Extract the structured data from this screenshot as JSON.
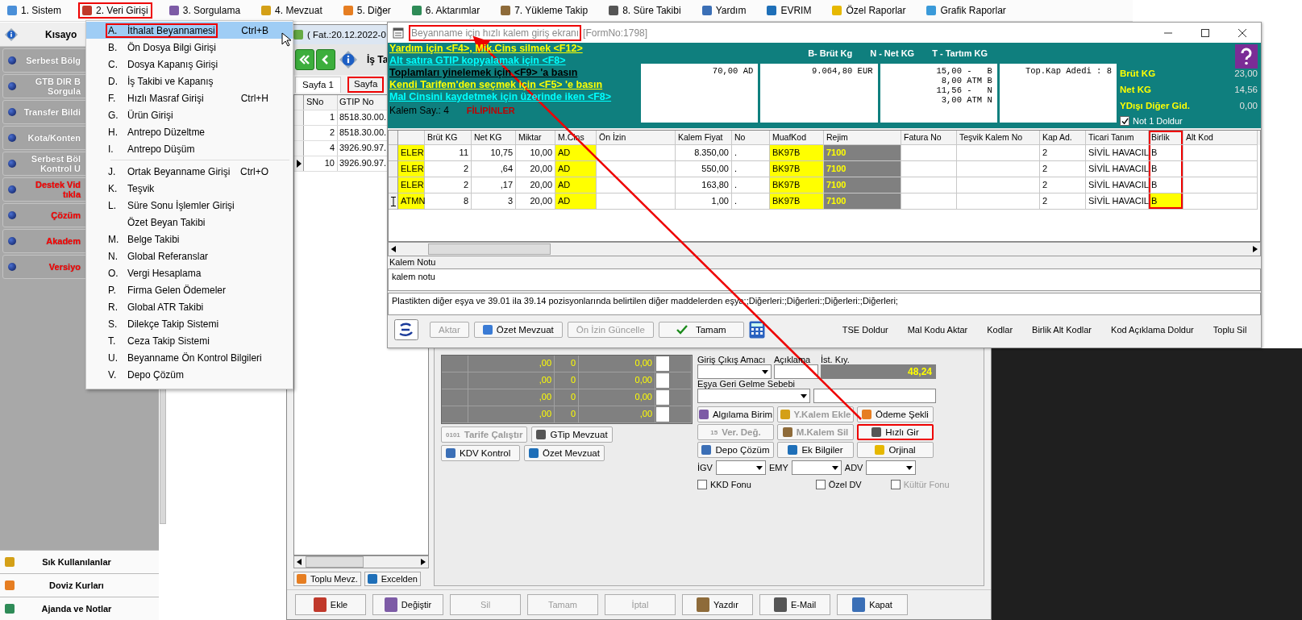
{
  "menu_bar": [
    {
      "label": "1. Sistem",
      "annotated": false
    },
    {
      "label": "2. Veri Girişi",
      "annotated": true
    },
    {
      "label": "3. Sorgulama",
      "annotated": false
    },
    {
      "label": "4. Mevzuat",
      "annotated": false
    },
    {
      "label": "5. Diğer",
      "annotated": false
    },
    {
      "label": "6. Aktarımlar",
      "annotated": false
    },
    {
      "label": "7. Yükleme Takip",
      "annotated": false
    },
    {
      "label": "8. Süre Takibi",
      "annotated": false
    },
    {
      "label": "Yardım",
      "annotated": false
    },
    {
      "label": "EVRIM",
      "annotated": false
    },
    {
      "label": "Özel Raporlar",
      "annotated": false
    },
    {
      "label": "Grafik Raporlar",
      "annotated": false
    }
  ],
  "sidebar": {
    "header": "Kısayo",
    "items": [
      {
        "lines": [
          "Serbest Bölg"
        ],
        "color": "#ffffff"
      },
      {
        "lines": [
          "GTB DIR B",
          "Sorgula"
        ],
        "color": "#ffffff"
      },
      {
        "lines": [
          "Transfer Bildi"
        ],
        "color": "#ffffff"
      },
      {
        "lines": [
          "Kota/Konten"
        ],
        "color": "#ffffff"
      },
      {
        "lines": [
          "Serbest Böl",
          "Kontrol U"
        ],
        "color": "#ffffff"
      },
      {
        "lines": [
          "Destek Vid",
          "tıkla"
        ],
        "color": "#ff0000"
      },
      {
        "lines": [
          "Çözüm"
        ],
        "color": "#ff0000"
      },
      {
        "lines": [
          "Akadem"
        ],
        "color": "#ff0000"
      },
      {
        "lines": [
          "Versiyo"
        ],
        "color": "#ff0000"
      }
    ],
    "bottom": [
      "Sık Kullanılanlar",
      "Doviz Kurları",
      "Ajanda ve Notlar"
    ]
  },
  "veri_girisi_menu": {
    "groups": [
      [
        {
          "letter": "A.",
          "text": "İthalat Beyannamesi",
          "shortcut": "Ctrl+B",
          "selected": true,
          "annotated": true
        },
        {
          "letter": "B.",
          "text": "Ön Dosya Bilgi Girişi",
          "selected": false,
          "annotated": false
        },
        {
          "letter": "C.",
          "text": "Dosya Kapanış Girişi",
          "selected": false,
          "annotated": false
        },
        {
          "letter": "D.",
          "text": "İş Takibi ve Kapanış",
          "selected": false,
          "annotated": false
        },
        {
          "letter": "F.",
          "text": "Hızlı Masraf Girişi",
          "shortcut": "Ctrl+H",
          "selected": false,
          "annotated": false
        },
        {
          "letter": "G.",
          "text": "Ürün Girişi",
          "selected": false,
          "annotated": false
        },
        {
          "letter": "H.",
          "text": "Antrepo Düzeltme",
          "selected": false,
          "annotated": false
        },
        {
          "letter": "I.",
          "text": "Antrepo Düşüm",
          "selected": false,
          "annotated": false
        }
      ],
      [
        {
          "letter": "J.",
          "text": "Ortak Beyanname Girişi",
          "shortcut": "Ctrl+O",
          "selected": false,
          "annotated": false
        },
        {
          "letter": "K.",
          "text": "Teşvik",
          "selected": false,
          "annotated": false
        },
        {
          "letter": "L.",
          "text": "Süre Sonu İşlemler Girişi",
          "selected": false,
          "annotated": false
        },
        {
          "text": "Özet Beyan Takibi",
          "selected": false,
          "annotated": false
        },
        {
          "letter": "M.",
          "text": "Belge Takibi",
          "selected": false,
          "annotated": false
        },
        {
          "letter": "N.",
          "text": "Global Referanslar",
          "selected": false,
          "annotated": false
        },
        {
          "letter": "O.",
          "text": "Vergi Hesaplama",
          "selected": false,
          "annotated": false
        },
        {
          "letter": "P.",
          "text": "Firma Gelen Ödemeler",
          "selected": false,
          "annotated": false
        },
        {
          "letter": "R.",
          "text": "Global ATR Takibi",
          "selected": false,
          "annotated": false
        },
        {
          "letter": "S.",
          "text": "Dilekçe Takip Sistemi",
          "selected": false,
          "annotated": false
        },
        {
          "letter": "T.",
          "text": "Ceza Takip Sistemi",
          "selected": false,
          "annotated": false
        },
        {
          "letter": "U.",
          "text": "Beyanname Ön Kontrol Bilgileri",
          "selected": false,
          "annotated": false
        },
        {
          "letter": "V.",
          "text": "Depo Çözüm",
          "selected": false,
          "annotated": false
        }
      ]
    ]
  },
  "main_window": {
    "title": "( Fat.:20.12.2022-0",
    "heading": "İş Ta",
    "tabs": [
      {
        "label": "Sayfa 1",
        "selected": true,
        "annotated": false
      },
      {
        "label": "Sayfa",
        "selected": false,
        "annotated": true
      }
    ],
    "item_list": {
      "columns": [
        "SNo",
        "GTIP No"
      ],
      "rows": [
        {
          "sno": "1",
          "gtip": "8518.30.00.",
          "current": false
        },
        {
          "sno": "2",
          "gtip": "8518.30.00.",
          "current": false
        },
        {
          "sno": "4",
          "gtip": "3926.90.97.",
          "current": false
        },
        {
          "sno": "10",
          "gtip": "3926.90.97.",
          "current": true
        }
      ]
    },
    "list_buttons": [
      "Toplu Mevz.",
      "Excelden"
    ],
    "cost_rows": [
      {
        "amount": ",00",
        "count": "0",
        "total": "0,00"
      },
      {
        "amount": ",00",
        "count": "0",
        "total": "0,00"
      },
      {
        "amount": ",00",
        "count": "0",
        "total": "0,00"
      },
      {
        "amount": ",00",
        "count": "0",
        "total": ",00"
      }
    ],
    "left_buttons": [
      {
        "label": "Tarife Çalıştır",
        "prefix": "0101",
        "disabled": true
      },
      {
        "label": "GTip Mevzuat",
        "disabled": false
      },
      {
        "label": "KDV Kontrol",
        "disabled": false
      },
      {
        "label": "Özet Mevzuat",
        "disabled": false
      }
    ],
    "form": {
      "giris_cikis_label": "Giriş Çıkış Amacı",
      "aciklama_label": "Açıklama",
      "ist_kiy_label": "İst. Kıy.",
      "ist_kiy_value": "48,24",
      "esya_geri_label": "Eşya Geri Gelme Sebebi"
    },
    "action_buttons": [
      {
        "label": "Algılama Birim",
        "disabled": false,
        "annotated": false
      },
      {
        "label": "Y.Kalem Ekle",
        "disabled": true,
        "annotated": false
      },
      {
        "label": "Ödeme Şekli",
        "disabled": false,
        "annotated": false
      },
      {
        "label": "Ver. Değ.",
        "prefix": "15",
        "disabled": true,
        "annotated": false
      },
      {
        "label": "M.Kalem Sil",
        "disabled": true,
        "annotated": false
      },
      {
        "label": "Hızlı Gir",
        "disabled": false,
        "annotated": true
      },
      {
        "label": "Depo Çözüm",
        "disabled": false,
        "annotated": false
      },
      {
        "label": "Ek Bilgiler",
        "disabled": false,
        "annotated": false
      },
      {
        "label": "Orjinal",
        "disabled": false,
        "annotated": false
      }
    ],
    "selects": [
      "İGV",
      "EMY",
      "ADV"
    ],
    "checkboxes": [
      {
        "label": "KKD Fonu",
        "checked": false,
        "disabled": false
      },
      {
        "label": "Özel DV",
        "checked": false,
        "disabled": false
      },
      {
        "label": "Kültür Fonu",
        "checked": false,
        "disabled": true
      }
    ],
    "bottom_buttons": [
      {
        "label": "Ekle",
        "disabled": false
      },
      {
        "label": "Değiştir",
        "disabled": false
      },
      {
        "label": "Sil",
        "disabled": true
      },
      {
        "label": "Tamam",
        "disabled": true
      },
      {
        "label": "İptal",
        "disabled": true
      },
      {
        "label": "Yazdır",
        "disabled": false
      },
      {
        "label": "E-Mail",
        "disabled": false
      },
      {
        "label": "Kapat",
        "disabled": false
      }
    ]
  },
  "quick_entry_window": {
    "title": "Beyanname için hızlı kalem giriş ekranı",
    "title_annotated": true,
    "form_no": "[FormNo:1798]",
    "hints": [
      {
        "text": "Yardım için <F4>, Mik.Cins silmek <F12>",
        "color": "#ffff00"
      },
      {
        "text": "Alt satıra GTIP kopyalamak için <F8>",
        "color": "#00ffff"
      },
      {
        "text": "Toplamları yinelemek için <F9> 'a basın",
        "color": "#000000"
      },
      {
        "text": "Kendi Tarifem'den seçmek  için <F5> 'e basın",
        "color": "#ffff00"
      },
      {
        "text": "Mal Cinsini kaydetmek için üzerinde iken <F8>",
        "color": "#00ffff"
      }
    ],
    "kalem_say": "Kalem Say.: 4",
    "country": "FİLİPİNLER",
    "legend": [
      "B- Brüt Kg",
      "N - Net KG",
      "T - Tartım KG"
    ],
    "summary_boxes": [
      [
        "70,00 AD"
      ],
      [
        "9.064,80 EUR"
      ],
      [
        "15,00 -   B",
        "8,00 ATM B",
        "11,56 -   N",
        "3,00 ATM N"
      ],
      [
        "Top.Kap Adedi : 8"
      ]
    ],
    "totals": [
      {
        "label": "Brüt KG",
        "value": "23,00"
      },
      {
        "label": "Net KG",
        "value": "14,56"
      },
      {
        "label": "YDışı Diğer Gid.",
        "value": "0,00"
      }
    ],
    "not1_doldur": {
      "label": "Not 1 Doldur",
      "checked": true
    },
    "grid": {
      "columns": [
        {
          "kind": "highlighted",
          "annotated": false
        },
        {
          "label": "Brüt KG",
          "kind": "number",
          "annotated": false
        },
        {
          "label": "Net KG",
          "kind": "number",
          "annotated": false
        },
        {
          "label": "Miktar",
          "kind": "number",
          "annotated": false
        },
        {
          "label": "M.Cins",
          "kind": "highlighted",
          "annotated": false
        },
        {
          "label": "Ön İzin",
          "kind": "text",
          "annotated": false
        },
        {
          "label": "Kalem Fiyat",
          "kind": "number",
          "annotated": false
        },
        {
          "label": "No",
          "kind": "text",
          "annotated": false
        },
        {
          "label": "MuafKod",
          "kind": "highlighted",
          "annotated": false
        },
        {
          "label": "Rejim",
          "kind": "code",
          "annotated": false
        },
        {
          "label": "Fatura No",
          "kind": "text",
          "annotated": false
        },
        {
          "label": "Teşvik Kalem No",
          "kind": "text",
          "annotated": false
        },
        {
          "label": "Kap Ad.",
          "kind": "text",
          "annotated": false
        },
        {
          "label": "Ticari Tanım",
          "kind": "text",
          "annotated": false
        },
        {
          "label": "Birlik",
          "kind": "editable",
          "annotated": true
        },
        {
          "label": "Alt Kod",
          "kind": "text",
          "annotated": false
        }
      ],
      "rows": [
        {
          "editing": false,
          "column_1": "ELER",
          "brut_kg": "11",
          "net_kg": "10,75",
          "miktar": "10,00",
          "m_cins": "AD",
          "kalem_fiyat": "8.350,00",
          "no": ".",
          "muaf_kod": "BK97B",
          "rejim": "7100",
          "kap_ad": "2",
          "ticari_tanim": "SİVİL HAVACIL",
          "birlik": "B"
        },
        {
          "editing": false,
          "column_1": "ELER",
          "brut_kg": "2",
          "net_kg": ",64",
          "miktar": "20,00",
          "m_cins": "AD",
          "kalem_fiyat": "550,00",
          "no": ".",
          "muaf_kod": "BK97B",
          "rejim": "7100",
          "kap_ad": "2",
          "ticari_tanim": "SİVİL HAVACIL",
          "birlik": "B"
        },
        {
          "editing": false,
          "column_1": "ELER",
          "brut_kg": "2",
          "net_kg": ",17",
          "miktar": "20,00",
          "m_cins": "AD",
          "kalem_fiyat": "163,80",
          "no": ".",
          "muaf_kod": "BK97B",
          "rejim": "7100",
          "kap_ad": "2",
          "ticari_tanim": "SİVİL HAVACIL",
          "birlik": "B"
        },
        {
          "editing": true,
          "column_1": "ATMN",
          "brut_kg": "8",
          "net_kg": "3",
          "miktar": "20,00",
          "m_cins": "AD",
          "kalem_fiyat": "1,00",
          "no": ".",
          "muaf_kod": "BK97B",
          "rejim": "7100",
          "kap_ad": "2",
          "ticari_tanim": "SİVİL HAVACIL",
          "birlik": "B"
        }
      ]
    },
    "kalem_notu": {
      "label": "Kalem Notu",
      "value": "kalem notu"
    },
    "description": "Plastikten diğer eşya ve 39.01 ila 39.14 pozisyonlarında belirtilen diğer maddelerden eşya:;Diğerleri:;Diğerleri:;Diğerleri:;Diğerleri;",
    "toolbar": [
      {
        "label": "Aktar",
        "kind": "plain",
        "disabled": true
      },
      {
        "label": "Özet Mevzuat",
        "kind": "plain",
        "disabled": false
      },
      {
        "label": "Ön İzin Güncelle",
        "kind": "plain",
        "disabled": true
      },
      {
        "label": "Tamam",
        "kind": "confirm",
        "disabled": false
      }
    ],
    "links": [
      "TSE Doldur",
      "Mal Kodu Aktar",
      "Kodlar",
      "Birlik Alt Kodlar",
      "Kod Açıklama Doldur",
      "Toplu Sil"
    ]
  }
}
